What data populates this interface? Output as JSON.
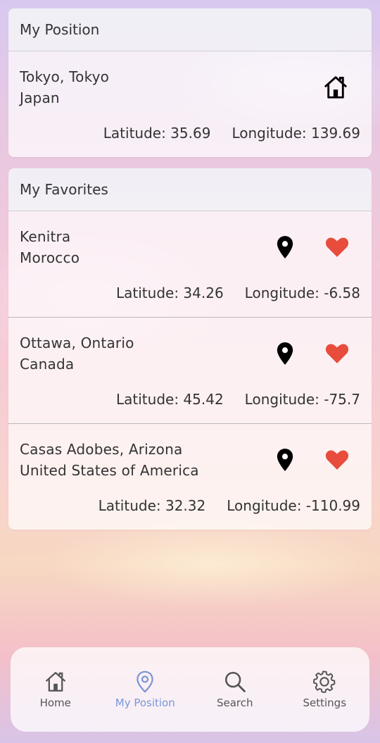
{
  "position_card": {
    "title": "My Position",
    "city": "Tokyo, Tokyo",
    "country": "Japan",
    "latitude": "Latitude: 35.69",
    "longitude": "Longitude: 139.69"
  },
  "favorites_card": {
    "title": "My Favorites",
    "items": [
      {
        "city": "Kenitra",
        "country": "Morocco",
        "latitude": "Latitude: 34.26",
        "longitude": "Longitude: -6.58"
      },
      {
        "city": "Ottawa, Ontario",
        "country": "Canada",
        "latitude": "Latitude: 45.42",
        "longitude": "Longitude: -75.7"
      },
      {
        "city": "Casas Adobes, Arizona",
        "country": "United States of America",
        "latitude": "Latitude: 32.32",
        "longitude": "Longitude: -110.99"
      }
    ]
  },
  "nav": {
    "home": "Home",
    "position": "My Position",
    "search": "Search",
    "settings": "Settings"
  },
  "colors": {
    "heart": "#e74c3c",
    "active_nav": "#7b96d8"
  }
}
